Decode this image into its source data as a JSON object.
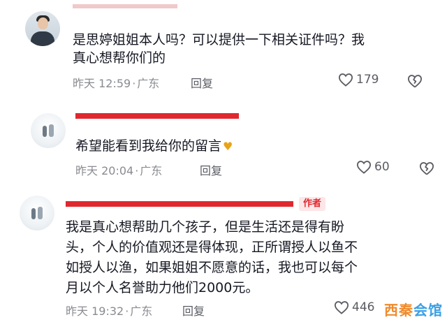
{
  "comments": [
    {
      "name_redacted": "",
      "text": "是思婷姐姐本人吗？可以提供一下相关证件吗？我真心想帮你们的",
      "text_line1": "是思婷姐姐本人吗？可以提供一下相关证件吗？我",
      "text_line2": "真心想帮你们的",
      "time": "昨天 12:59",
      "dot": "·",
      "location": "广东",
      "reply_label": "回复",
      "likes": "179",
      "avatar_icon": "person-avatar-icon"
    },
    {
      "text": "希望能看到我给你的留言",
      "emoji": "🫰",
      "time": "昨天 20:04",
      "dot": "·",
      "location": "广东",
      "reply_label": "回复",
      "likes": "60",
      "avatar_icon": "scene-avatar-icon"
    },
    {
      "author_badge": "作者",
      "text_line1": "我是真心想帮助几个孩子，但是生活还是得有盼",
      "text_line2": "头，个人的价值观还是得体现，正所谓授人以鱼不",
      "text_line3": "如授人以渔，如果姐姐不愿意的话，我也可以每个",
      "text_line4": "月以个人名誉助力他们2000元。",
      "time": "昨天 19:32",
      "dot": "·",
      "location": "广东",
      "reply_label": "回复",
      "likes": "446",
      "avatar_icon": "scene-avatar-icon"
    }
  ],
  "watermark": {
    "part1": "西秦",
    "part2": "会馆"
  },
  "colors": {
    "redaction": "#e0282f",
    "meta": "#8a8b91",
    "text": "#161823",
    "author_badge_bg": "#fde6e7"
  }
}
